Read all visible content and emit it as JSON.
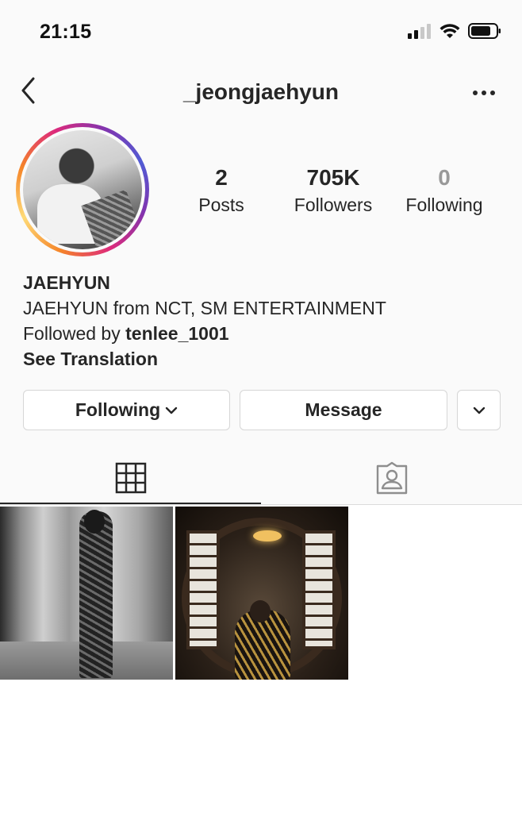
{
  "status_bar": {
    "time": "21:15"
  },
  "header": {
    "username": "_jeongjaehyun"
  },
  "stats": [
    {
      "value": "2",
      "label": "Posts"
    },
    {
      "value": "705K",
      "label": "Followers"
    },
    {
      "value": "0",
      "label": "Following"
    }
  ],
  "bio": {
    "name": "JAEHYUN",
    "description": "JAEHYUN from NCT, SM ENTERTAINMENT",
    "followed_by_prefix": "Followed by",
    "followed_by_user": "tenlee_1001",
    "see_translation": "See Translation"
  },
  "actions": {
    "following_label": "Following",
    "message_label": "Message"
  },
  "tabs": [
    {
      "icon": "grid-icon",
      "active": true
    },
    {
      "icon": "tagged-user-icon",
      "active": false
    }
  ],
  "posts_count_shown": 2,
  "colors": {
    "text": "#262626",
    "muted": "#999999",
    "border": "#d6d6d6",
    "background": "#fafafa"
  }
}
